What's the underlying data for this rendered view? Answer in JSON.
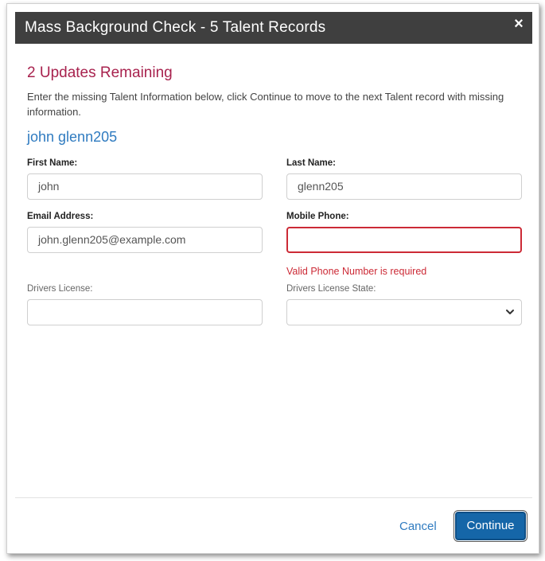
{
  "dialog": {
    "title": "Mass Background Check - 5 Talent Records",
    "close_glyph": "×",
    "remaining": "2 Updates Remaining",
    "instructions": "Enter the missing Talent Information below, click Continue to move to the next Talent record with missing information.",
    "talent_name": "john glenn205"
  },
  "form": {
    "first_name": {
      "label": "First Name:",
      "value": "john"
    },
    "last_name": {
      "label": "Last Name:",
      "value": "glenn205"
    },
    "email": {
      "label": "Email Address:",
      "value": "john.glenn205@example.com"
    },
    "mobile_phone": {
      "label": "Mobile Phone:",
      "value": "",
      "error": "Valid Phone Number is required"
    },
    "drivers_license": {
      "label": "Drivers License:",
      "value": ""
    },
    "drivers_license_state": {
      "label": "Drivers License State:",
      "value": ""
    }
  },
  "footer": {
    "cancel_label": "Cancel",
    "continue_label": "Continue"
  },
  "colors": {
    "header_bg": "#3f3f3f",
    "remaining_text": "#a8224e",
    "link_blue": "#2f7bc0",
    "error_red": "#cc2a36",
    "primary_button": "#1566a8"
  },
  "icons": {
    "close": "close-icon",
    "select": "chevron-down-icon"
  }
}
